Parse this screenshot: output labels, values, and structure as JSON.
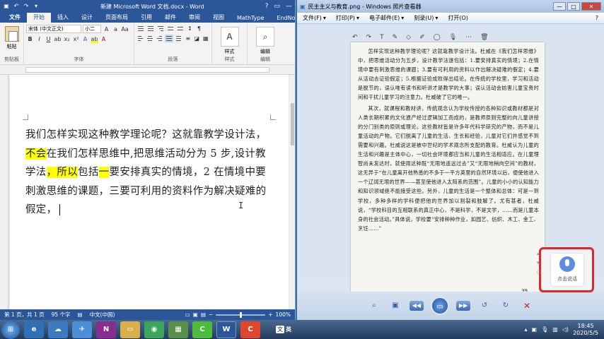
{
  "word": {
    "window_title": "新建 Microsoft Word 文档.docx - Word",
    "help": "?",
    "tabs": [
      "文件",
      "开始",
      "插入",
      "设计",
      "页面布局",
      "引用",
      "邮件",
      "审阅",
      "视图",
      "MathType",
      "EndNote"
    ],
    "active_tab": "开始",
    "ribbon": {
      "clipboard_label": "剪贴板",
      "paste_label": "粘贴",
      "font_name": "宋体 (中文正文)",
      "font_size": "小二",
      "font_label": "字体",
      "paragraph_label": "段落",
      "styles_label": "样式",
      "styles_button": "样式",
      "editing_label": "编辑",
      "editing_button": "编辑"
    },
    "document": {
      "segments": [
        {
          "text": "我们怎样实现这种教学理论呢？这就靠教学设计法，",
          "hl": false
        },
        {
          "text": "不会",
          "hl": true
        },
        {
          "text": "在我们怎样思维中,把思维活动分为 5 步,设计教学法",
          "hl": false
        },
        {
          "text": "，所以",
          "hl": true
        },
        {
          "text": "包括",
          "hl": false
        },
        {
          "text": "一",
          "hl": true
        },
        {
          "text": "要安排真实的情境，2 在情境中要刺激思维的课题，三要可利用的资料作为解决疑难的假定，",
          "hl": false
        }
      ]
    },
    "status": {
      "page": "第 1 页，共 1 页",
      "words": "95 个字",
      "lang": "中文(中国)",
      "zoom": "100%",
      "zoom_fraction": 0.5
    }
  },
  "viewer": {
    "window_title": "民主主义与教育.png - Windows 照片查看器",
    "menu": [
      "文件(F)",
      "打印(P)",
      "电子邮件(E)",
      "刻录(U)",
      "打开(O)"
    ],
    "help": "?",
    "scan_paragraphs": [
      "怎样实现这种教学理论呢？这就靠教学设计法。杜威在《我们怎样思维》中，把思维活动分为五步，设计教学法遂包括：1.要安排真实的情境；2.在情境中要有刺激思维的课题；3.要有可利用的资料以作出解决疑难的假定；4.要从活动去证验假定；5.根据证验成败得出结论。在传统的学校里，学习和活动是脱节的，误认唯有读书和听讲才是教学的大事；误认活动会妨害儿童宝贵时间和干扰儿童学习的注意力。杜威破了它的唯一。",
      "其次，就课程和教材讲，传统观念认为学校传授的各种知识或教材都是对人类长期积累的文化遗产经过逻辑加工而成的，是教师原则完整的向儿童讲授的分门别类的原则或理论。这些教材皆是许多年代科学研究的产物，而不是儿童活动的产物。它们脱离了儿童的生活、生长和经验，儿童对它们并感觉不到需要和兴趣。杜威说这是被中世纪的学术观念所支配的教育。杜威认为儿童的生活和兴趣是主体中心，一切社会环境都应当和儿童的生活相适应。在儿童理智尚未发达时，就使用这种既“无限地遥远过去”又“无限地稍向空间”的教材，这无异于“在儿童离开他熟悉的不多于一平方英里的自然环境以后，便使他进入一个辽阔无垠的世界——甚至使他进入太阳系的范围”。儿童的小小的认知能力和知识领域绝不能接受这些。另外，儿童的生活是一个整体和总体：可是一到学校，多种多样的学科便把他的世界加以割裂和肢解了。尤有甚者，杜威说，“学校科目的互相联系的真正中心，不是科学，不是文学，……而是儿童本身的社会活动。”具体说，学校要“安排种种作业，如园艺、纺织、木工、金工、烹饪……”"
    ],
    "page_number": "39"
  },
  "voice_widget": {
    "label": "点击说话"
  },
  "taskbar": {
    "lang_label": "英",
    "lang_badge": "文",
    "clock_time": "18:45",
    "clock_date": "2020/5/5"
  }
}
